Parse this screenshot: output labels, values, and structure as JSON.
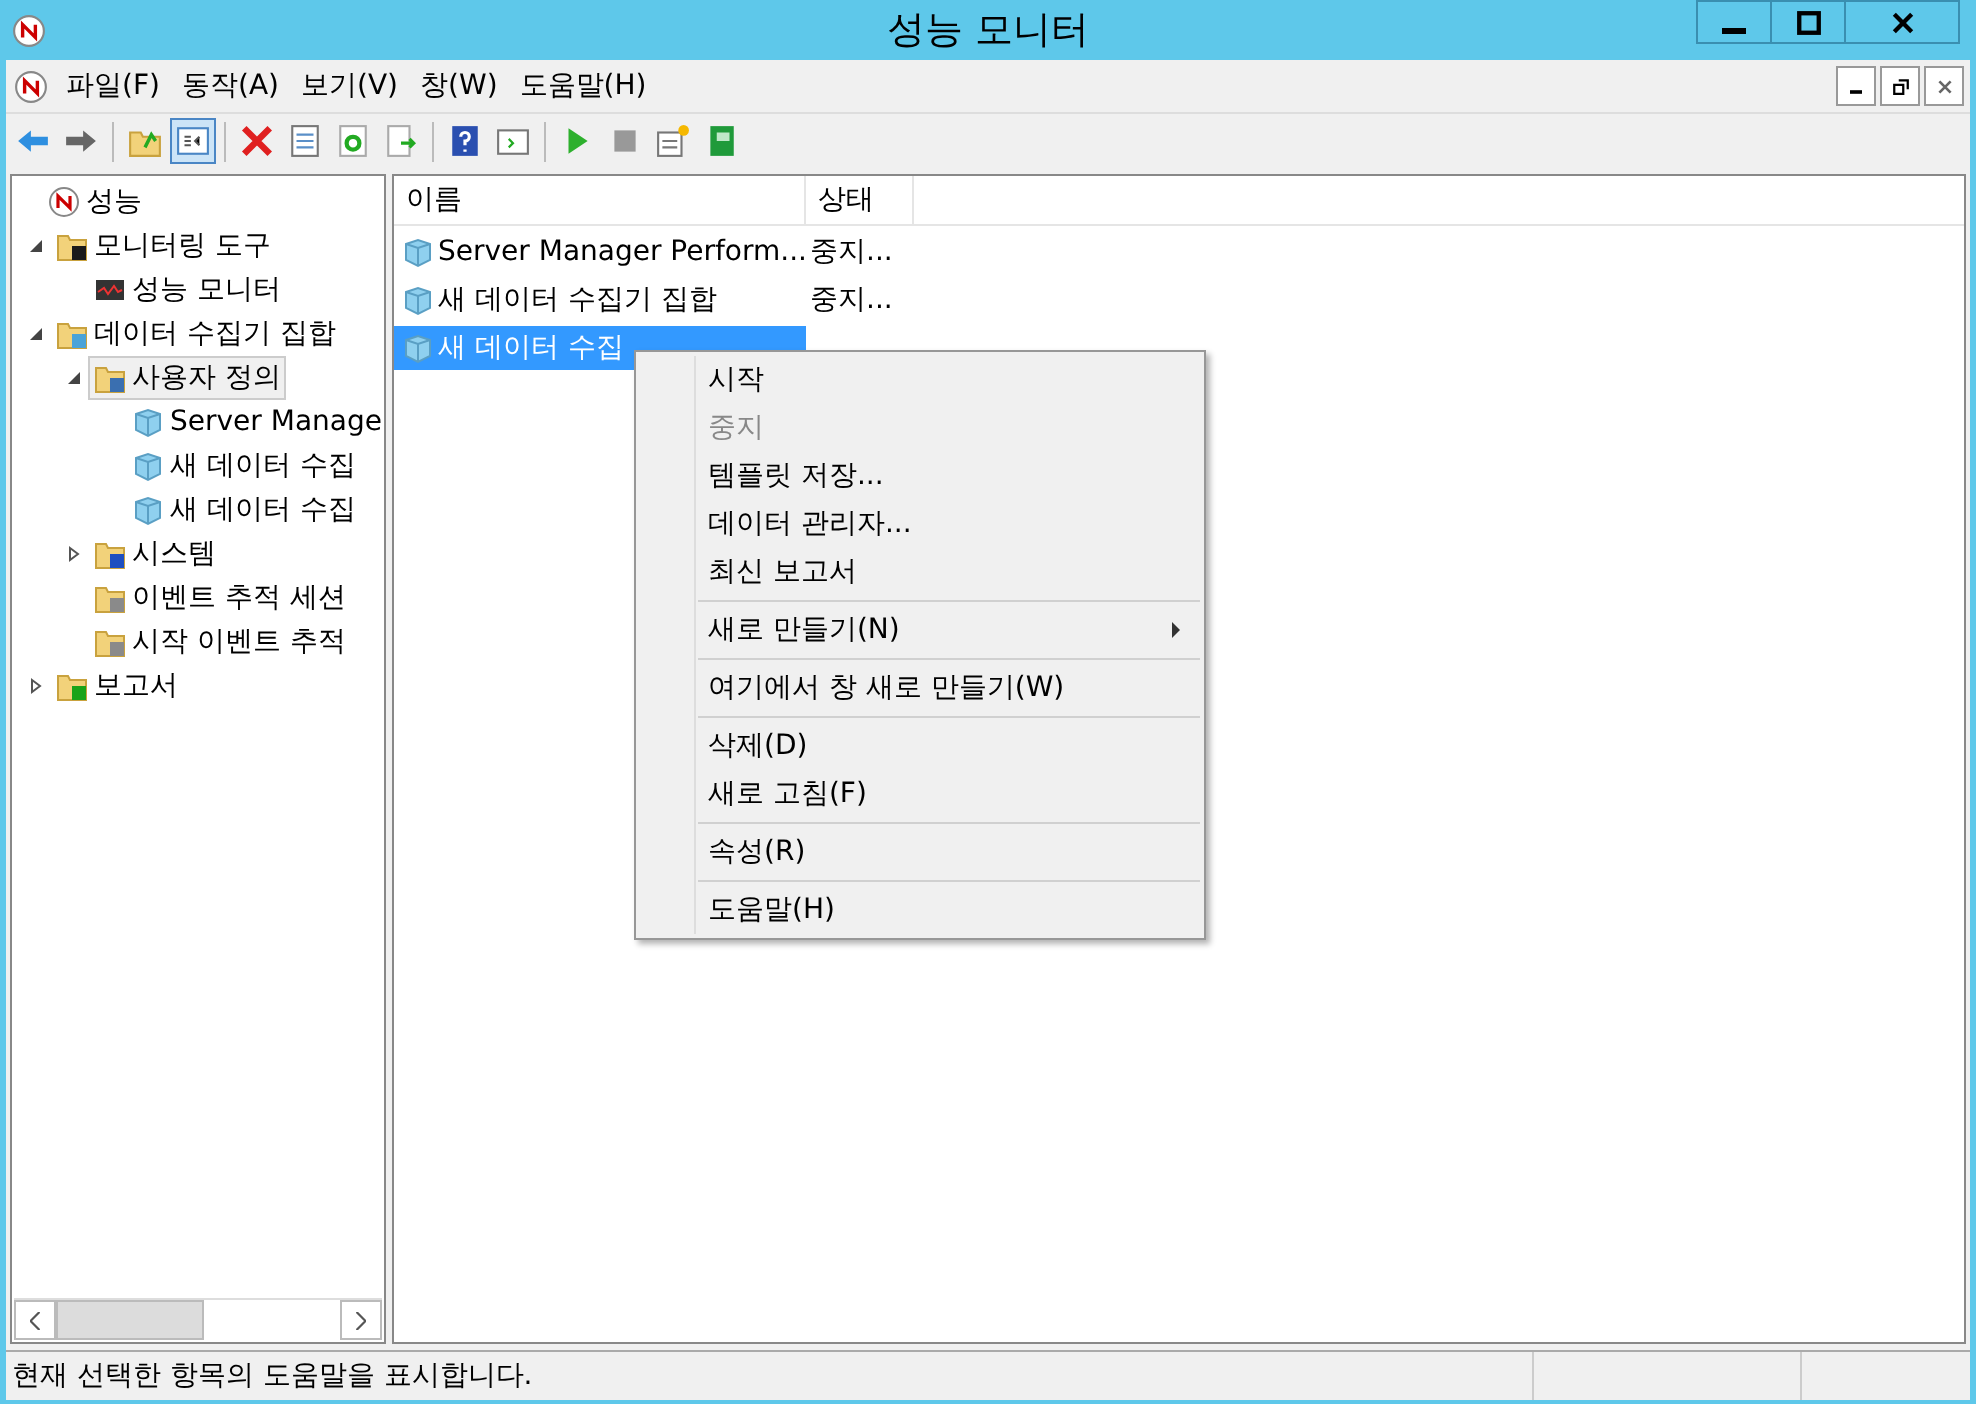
{
  "window": {
    "title": "성능 모니터"
  },
  "menubar": [
    "파일(F)",
    "동작(A)",
    "보기(V)",
    "창(W)",
    "도움말(H)"
  ],
  "tree": [
    {
      "label": "성능",
      "kind": "app",
      "selected": false,
      "children": [
        {
          "label": "모니터링 도구",
          "kind": "folder-chart",
          "expanded": true,
          "selected": false,
          "children": [
            {
              "label": "성능 모니터",
              "kind": "monitor",
              "selected": false
            }
          ]
        },
        {
          "label": "데이터 수집기 집합",
          "kind": "folder-data",
          "expanded": true,
          "selected": false,
          "children": [
            {
              "label": "사용자 정의",
              "kind": "folder-user",
              "expanded": true,
              "selected": true,
              "children": [
                {
                  "label": "Server Manage",
                  "kind": "cube",
                  "selected": false
                },
                {
                  "label": "새 데이터 수집",
                  "kind": "cube",
                  "selected": false
                },
                {
                  "label": "새 데이터 수집",
                  "kind": "cube",
                  "selected": false
                }
              ]
            },
            {
              "label": "시스템",
              "kind": "folder-system",
              "expanded": false,
              "selected": false
            },
            {
              "label": "이벤트 추적 세션",
              "kind": "folder-trace",
              "selected": false
            },
            {
              "label": "시작 이벤트 추적",
              "kind": "folder-trace",
              "selected": false
            }
          ]
        },
        {
          "label": "보고서",
          "kind": "folder-report",
          "expanded": false,
          "selected": false
        }
      ]
    }
  ],
  "table": {
    "columns": [
      "이름",
      "상태"
    ],
    "rows": [
      {
        "name": "Server Manager Perform...",
        "status": "중지...",
        "selected": false
      },
      {
        "name": "새 데이터 수집기 집합",
        "status": "중지...",
        "selected": false
      },
      {
        "name": "새 데이터 수집",
        "selected": true
      }
    ]
  },
  "context_menu": [
    {
      "kind": "item",
      "label": "시작",
      "disabled": false
    },
    {
      "kind": "item",
      "label": "중지",
      "disabled": true
    },
    {
      "kind": "item",
      "label": "템플릿 저장...",
      "disabled": false
    },
    {
      "kind": "item",
      "label": "데이터 관리자...",
      "disabled": false
    },
    {
      "kind": "item",
      "label": "최신 보고서",
      "disabled": false
    },
    {
      "kind": "separator"
    },
    {
      "kind": "item",
      "label": "새로 만들기(N)",
      "disabled": false,
      "submenu": true
    },
    {
      "kind": "separator"
    },
    {
      "kind": "item",
      "label": "여기에서 창 새로 만들기(W)",
      "disabled": false
    },
    {
      "kind": "separator"
    },
    {
      "kind": "item",
      "label": "삭제(D)",
      "disabled": false
    },
    {
      "kind": "item",
      "label": "새로 고침(F)",
      "disabled": false
    },
    {
      "kind": "separator"
    },
    {
      "kind": "item",
      "label": "속성(R)",
      "disabled": false
    },
    {
      "kind": "separator"
    },
    {
      "kind": "item",
      "label": "도움말(H)",
      "disabled": false
    }
  ],
  "status_bar": "현재 선택한 항목의 도움말을 표시합니다."
}
